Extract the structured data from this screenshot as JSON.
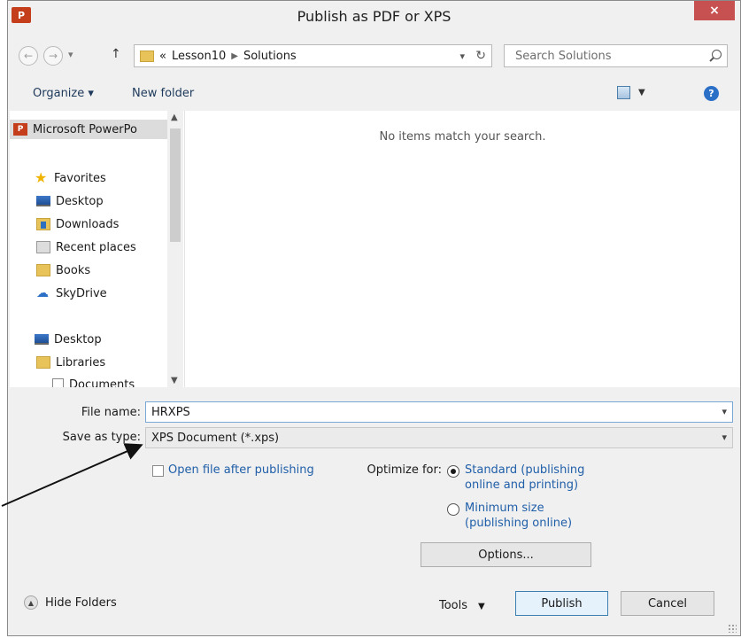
{
  "window": {
    "title": "Publish as PDF or XPS",
    "app_icon": "P",
    "close": "×"
  },
  "nav": {
    "back": "←",
    "forward": "→",
    "up": "↑",
    "recent_dd": "▾",
    "breadcrumb_prefix": "«",
    "crumbs": [
      "Lesson10",
      "Solutions"
    ],
    "search_placeholder": "Search Solutions"
  },
  "toolbar": {
    "organize": "Organize ▾",
    "new_folder": "New folder"
  },
  "navpane": {
    "items": [
      {
        "label": "Microsoft PowerPo",
        "icon": "powerpoint-icon"
      },
      {
        "label": "Favorites",
        "icon": "star-icon"
      },
      {
        "label": "Desktop",
        "icon": "desktop-icon"
      },
      {
        "label": "Downloads",
        "icon": "downloads-icon"
      },
      {
        "label": "Recent places",
        "icon": "recent-places-icon"
      },
      {
        "label": "Books",
        "icon": "folder-icon"
      },
      {
        "label": "SkyDrive",
        "icon": "skydrive-icon"
      },
      {
        "label": "Desktop",
        "icon": "desktop-icon"
      },
      {
        "label": "Libraries",
        "icon": "libraries-icon"
      },
      {
        "label": "Documents",
        "icon": "documents-icon"
      }
    ]
  },
  "content": {
    "empty_message": "No items match your search."
  },
  "form": {
    "file_name_label": "File name:",
    "file_name_value": "HRXPS",
    "save_type_label": "Save as type:",
    "save_type_value": "XPS Document (*.xps)",
    "open_after_label": "Open file after publishing",
    "optimize_label": "Optimize for:",
    "opt_standard": "Standard (publishing",
    "opt_standard_2": "online and printing)",
    "opt_minimum": "Minimum size",
    "opt_minimum_2": "(publishing online)",
    "options_button": "Options..."
  },
  "footer": {
    "hide_folders": "Hide Folders",
    "tools": "Tools",
    "publish": "Publish",
    "cancel": "Cancel"
  },
  "colors": {
    "accent": "#1f5ea8",
    "close": "#c75050",
    "app_icon": "#c43e1c"
  }
}
